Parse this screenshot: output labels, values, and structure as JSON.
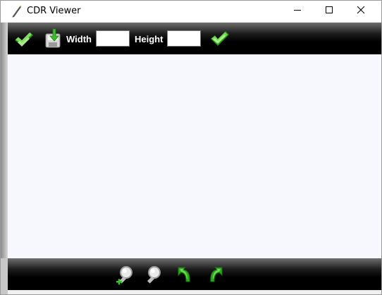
{
  "window": {
    "title": "CDR Viewer",
    "app_icon": "pen-icon",
    "controls": [
      "minimize-icon",
      "maximize-icon",
      "close-icon"
    ]
  },
  "toolbar": {
    "open_icon": "double-checkmark-icon",
    "save_icon": "save-download-icon",
    "width_label": "Width",
    "width_value": "",
    "height_label": "Height",
    "height_value": "",
    "apply_icon": "checkmark-icon"
  },
  "bottombar": {
    "icons": [
      "zoom-in-icon",
      "zoom-out-icon",
      "rotate-left-icon",
      "rotate-right-icon"
    ]
  },
  "colors": {
    "toolbar_bg": "#000000",
    "canvas_bg": "#f7f8fd",
    "accent_green": "#3fbf2a"
  }
}
